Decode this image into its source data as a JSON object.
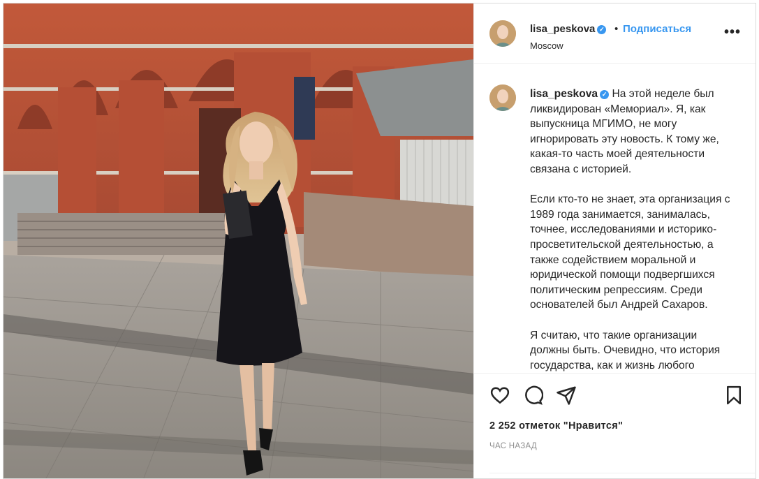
{
  "post": {
    "username": "lisa_peskova",
    "verified": true,
    "follow_label": "Подписаться",
    "separator": "•",
    "location": "Moscow",
    "more_icon": "more-horizontal-icon"
  },
  "caption": {
    "username": "lisa_peskova",
    "paragraphs": [
      "На этой неделе был ликвидирован «Мемориал». Я, как выпускница МГИМО, не могу игнорировать эту новость. К тому же, какая-то часть моей деятельности связана с историей.",
      "Если кто-то не знает, эта организация с 1989 года занимается, занималась, точнее, исследованиями и историко-просветительской деятельностью, а также содействием моральной и юридической помощи подвергшихся политическим репрессиям. Среди основателей был Андрей Сахаров.",
      "Я считаю, что такие организации должны быть. Очевидно, что история государства, как и жизнь любого"
    ]
  },
  "actions": {
    "like_icon": "heart-icon",
    "comment_icon": "comment-icon",
    "share_icon": "send-icon",
    "save_icon": "bookmark-icon"
  },
  "likes": "2 252 отметок \"Нравится\"",
  "time": "ЧАС НАЗАД",
  "colors": {
    "accent": "#3897f0",
    "text": "#262626",
    "muted": "#8e8e8e",
    "border": "#efefef"
  }
}
